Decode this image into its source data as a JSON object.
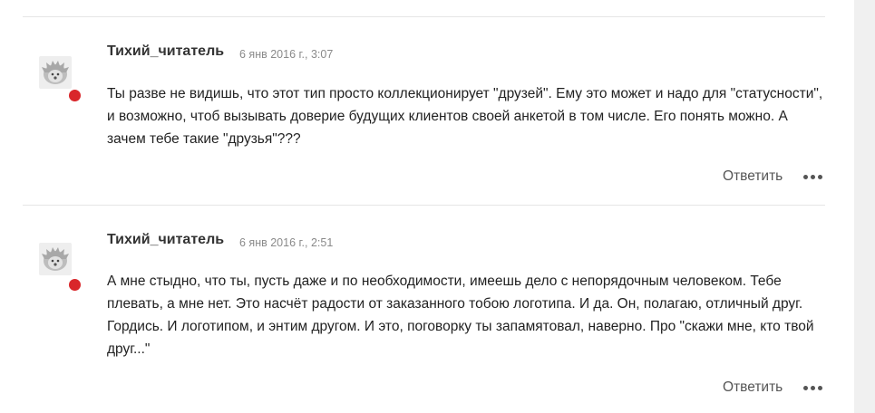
{
  "comments": [
    {
      "author": "Тихий_читатель",
      "date": "6 янв 2016 г., 3:07",
      "text": "Ты разве не видишь, что этот тип просто коллекционирует \"друзей\". Ему это может и надо для \"статусности\", и возможно, чтоб вызывать доверие будущих клиентов своей анкетой в том числе. Его понять можно. А зачем тебе такие \"друзья\"???",
      "reply_label": "Ответить",
      "avatar_icon": "hedgehog-avatar-icon",
      "status_color": "#d9262a"
    },
    {
      "author": "Тихий_читатель",
      "date": "6 янв 2016 г., 2:51",
      "text": "А мне стыдно, что ты, пусть даже и по необходимости, имеешь дело с непорядочным человеком. Тебе плевать, а мне нет. Это насчёт радости от заказанного тобою логотипа. И да. Он, полагаю, отличный друг. Гордись. И логотипом, и энтим другом. И это, поговорку ты запамятовал, наверно. Про \"скажи мне, кто твой друг...\"",
      "reply_label": "Ответить",
      "avatar_icon": "hedgehog-avatar-icon",
      "status_color": "#d9262a"
    }
  ]
}
